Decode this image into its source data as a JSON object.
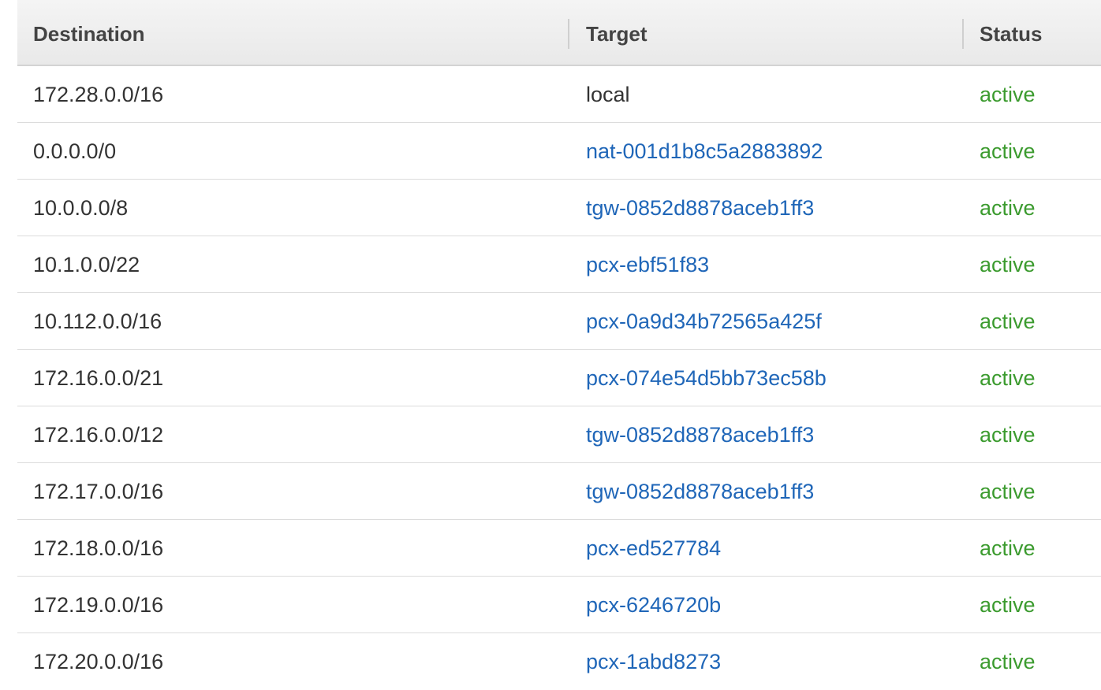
{
  "table": {
    "headers": {
      "destination": "Destination",
      "target": "Target",
      "status": "Status"
    },
    "rows": [
      {
        "destination": "172.28.0.0/16",
        "target": "local",
        "target_is_link": false,
        "status": "active"
      },
      {
        "destination": "0.0.0.0/0",
        "target": "nat-001d1b8c5a2883892",
        "target_is_link": true,
        "status": "active"
      },
      {
        "destination": "10.0.0.0/8",
        "target": "tgw-0852d8878aceb1ff3",
        "target_is_link": true,
        "status": "active"
      },
      {
        "destination": "10.1.0.0/22",
        "target": "pcx-ebf51f83",
        "target_is_link": true,
        "status": "active"
      },
      {
        "destination": "10.112.0.0/16",
        "target": "pcx-0a9d34b72565a425f",
        "target_is_link": true,
        "status": "active"
      },
      {
        "destination": "172.16.0.0/21",
        "target": "pcx-074e54d5bb73ec58b",
        "target_is_link": true,
        "status": "active"
      },
      {
        "destination": "172.16.0.0/12",
        "target": "tgw-0852d8878aceb1ff3",
        "target_is_link": true,
        "status": "active"
      },
      {
        "destination": "172.17.0.0/16",
        "target": "tgw-0852d8878aceb1ff3",
        "target_is_link": true,
        "status": "active"
      },
      {
        "destination": "172.18.0.0/16",
        "target": "pcx-ed527784",
        "target_is_link": true,
        "status": "active"
      },
      {
        "destination": "172.19.0.0/16",
        "target": "pcx-6246720b",
        "target_is_link": true,
        "status": "active"
      },
      {
        "destination": "172.20.0.0/16",
        "target": "pcx-1abd8273",
        "target_is_link": true,
        "status": "active"
      }
    ]
  },
  "colors": {
    "link": "#1f66b8",
    "status_active": "#3c9b2f",
    "text": "#333333",
    "header_text": "#444444"
  }
}
